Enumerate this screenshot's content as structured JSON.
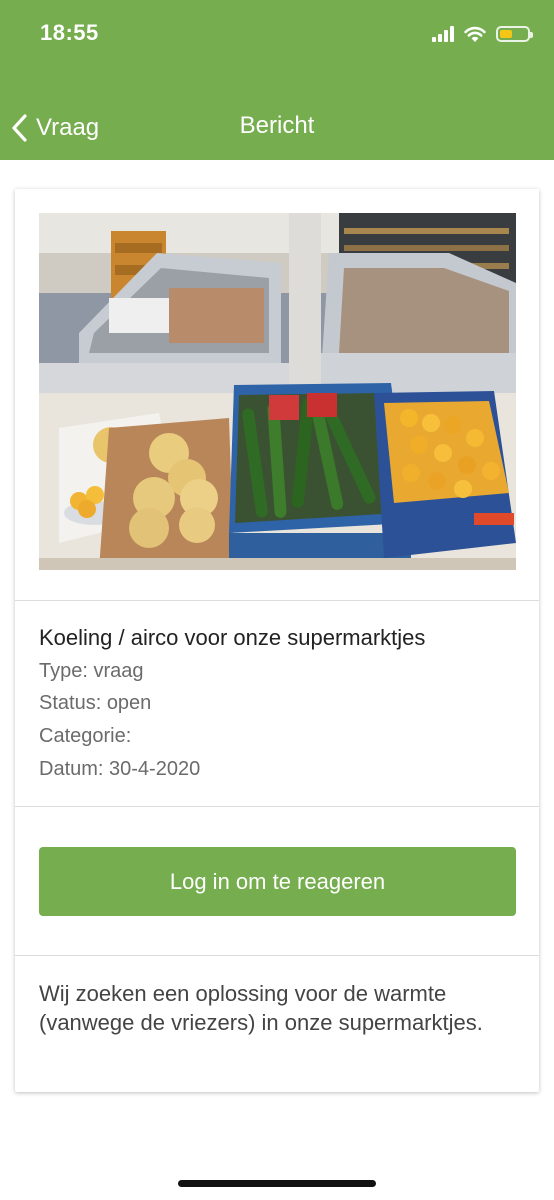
{
  "status_bar": {
    "time": "18:55",
    "battery_color": "#f5c518"
  },
  "nav": {
    "back_label": "Vraag",
    "title": "Bericht"
  },
  "post": {
    "title": "Koeling / airco voor onze supermarktjes",
    "type": "Type: vraag",
    "status": "Status: open",
    "category": "Categorie:",
    "date": "Datum: 30-4-2020",
    "login_button": "Log in om te reageren",
    "description": "Wij zoeken een oplossing voor de warmte (vanwege de vriezers) in onze supermarktjes."
  },
  "colors": {
    "brand_green": "#76ad4f"
  }
}
